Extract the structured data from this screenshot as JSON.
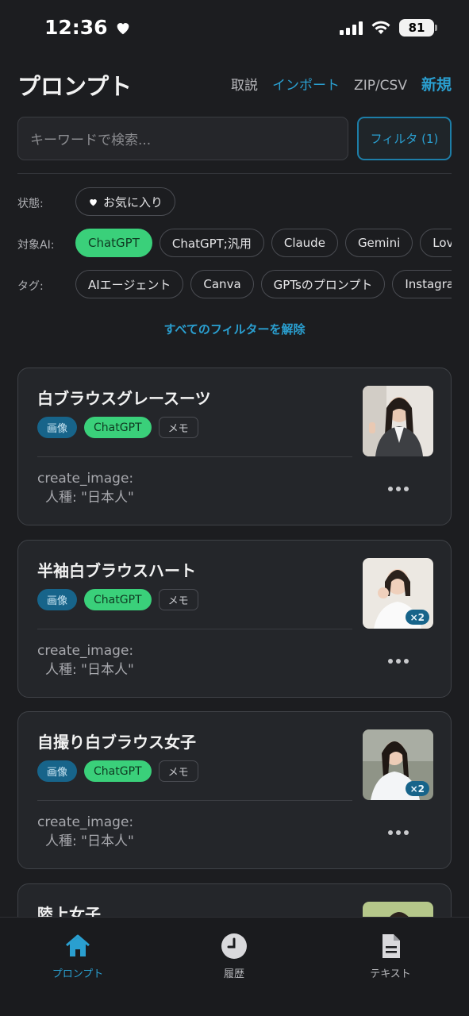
{
  "status_bar": {
    "time": "12:36",
    "battery": "81"
  },
  "header": {
    "title": "プロンプト",
    "actions": [
      "取説",
      "インポート",
      "ZIP/CSV",
      "新規"
    ]
  },
  "search": {
    "placeholder": "キーワードで検索...",
    "filter_button": "フィルタ (1)"
  },
  "filters": {
    "status": {
      "label": "状態:",
      "chips": [
        "お気に入り"
      ]
    },
    "target_ai": {
      "label": "対象AI:",
      "chips": [
        "ChatGPT",
        "ChatGPT;汎用",
        "Claude",
        "Gemini",
        "Lovable"
      ],
      "active": "ChatGPT"
    },
    "tags": {
      "label": "タグ:",
      "chips": [
        "AIエージェント",
        "Canva",
        "GPTsのプロンプト",
        "Instagram"
      ]
    },
    "clear_all": "すべてのフィルターを解除"
  },
  "cards": [
    {
      "title": "白ブラウスグレースーツ",
      "category": "画像",
      "ai": "ChatGPT",
      "memo": "メモ",
      "body_line1": "create_image:",
      "body_line2": "人種: \"日本人\"",
      "image_count": ""
    },
    {
      "title": "半袖白ブラウスハート",
      "category": "画像",
      "ai": "ChatGPT",
      "memo": "メモ",
      "body_line1": "create_image:",
      "body_line2": "人種: \"日本人\"",
      "image_count": "×2"
    },
    {
      "title": "自撮り白ブラウス女子",
      "category": "画像",
      "ai": "ChatGPT",
      "memo": "メモ",
      "body_line1": "create_image:",
      "body_line2": "人種: \"日本人\"",
      "image_count": "×2"
    },
    {
      "title": "陸上女子"
    }
  ],
  "bottom_nav": [
    {
      "label": "プロンプト",
      "icon": "home-icon",
      "active": true
    },
    {
      "label": "履歴",
      "icon": "clock-icon",
      "active": false
    },
    {
      "label": "テキスト",
      "icon": "document-icon",
      "active": false
    }
  ],
  "colors": {
    "accent": "#2a9fd0",
    "ai_green": "#3ad07a",
    "category_blue": "#17648a",
    "background": "#1c1d20",
    "card": "#24262a"
  }
}
